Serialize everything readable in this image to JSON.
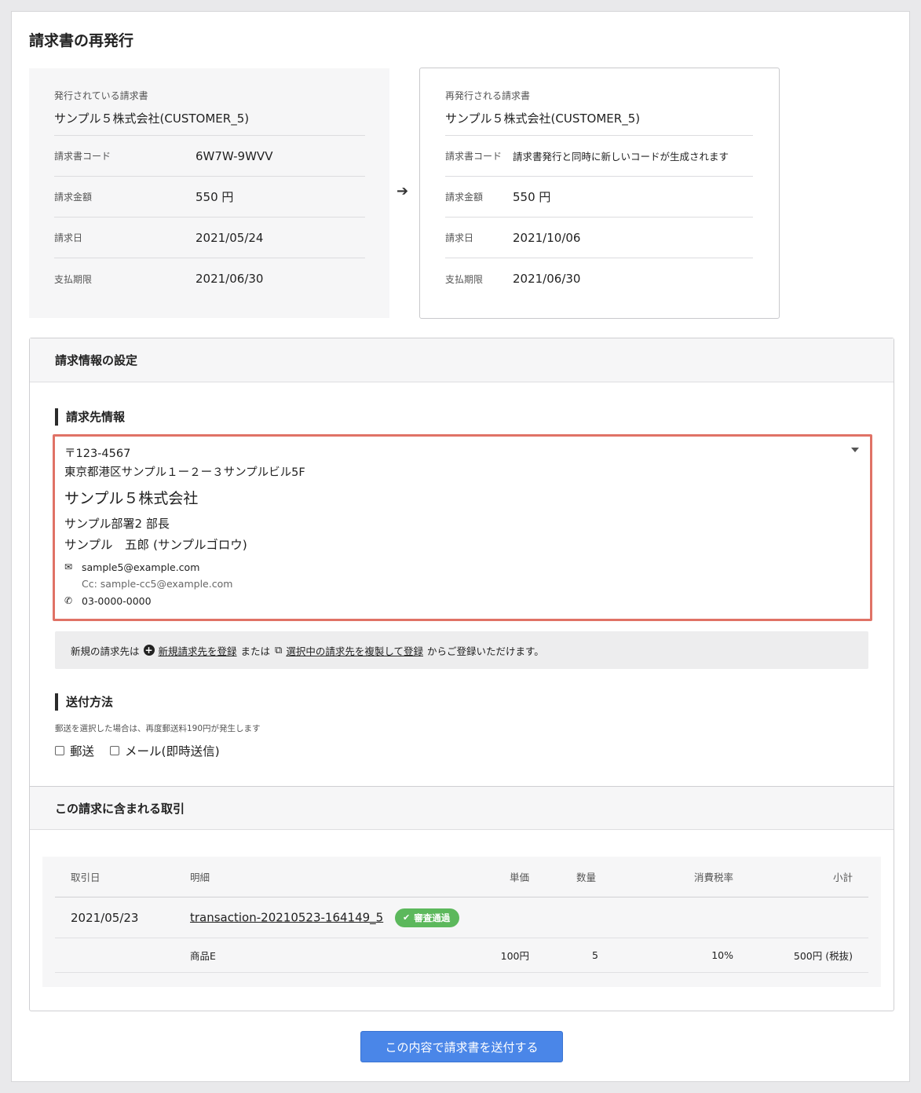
{
  "page": {
    "title": "請求書の再発行"
  },
  "issued_invoice": {
    "caption": "発行されている請求書",
    "customer": "サンプル５株式会社(CUSTOMER_5)",
    "rows": [
      {
        "label": "請求書コード",
        "value": "6W7W-9WVV"
      },
      {
        "label": "請求金額",
        "value": "550 円"
      },
      {
        "label": "請求日",
        "value": "2021/05/24"
      },
      {
        "label": "支払期限",
        "value": "2021/06/30"
      }
    ]
  },
  "reissued_invoice": {
    "caption": "再発行される請求書",
    "customer": "サンプル５株式会社(CUSTOMER_5)",
    "rows": [
      {
        "label": "請求書コード",
        "value": "請求書発行と同時に新しいコードが生成されます"
      },
      {
        "label": "請求金額",
        "value": "550 円"
      },
      {
        "label": "請求日",
        "value": "2021/10/06"
      },
      {
        "label": "支払期限",
        "value": "2021/06/30"
      }
    ]
  },
  "settings": {
    "header": "請求情報の設定",
    "billing_section_title": "請求先情報",
    "billing": {
      "postal": "〒123-4567",
      "address": "東京都港区サンプル１ー２ー３サンプルビル5F",
      "company": "サンプル５株式会社",
      "department": "サンプル部署2 部長",
      "person": "サンプル　五郎 (サンプルゴロウ)",
      "email": "sample5@example.com",
      "cc": "Cc: sample-cc5@example.com",
      "tel": "03-0000-0000"
    },
    "notice": {
      "prefix": "新規の請求先は",
      "new_link": "新規請求先を登録",
      "middle": "または",
      "copy_link": "選択中の請求先を複製して登録",
      "suffix": "からご登録いただけます。"
    },
    "shipping_section_title": "送付方法",
    "shipping_note": "郵送を選択した場合は、再度郵送料190円が発生します",
    "shipping_options": [
      "郵送",
      "メール(即時送信)"
    ]
  },
  "transactions": {
    "header": "この請求に含まれる取引",
    "columns": {
      "date": "取引日",
      "detail": "明細",
      "price": "単価",
      "qty": "数量",
      "tax": "消費税率",
      "subtotal": "小計"
    },
    "row": {
      "date": "2021/05/23",
      "id": "transaction-20210523-164149_5",
      "badge": "審査通過"
    },
    "item": {
      "name": "商品E",
      "price": "100円",
      "qty": "5",
      "tax": "10%",
      "subtotal": "500円 (税抜)"
    }
  },
  "submit_label": "この内容で請求書を送付する",
  "colors": {
    "highlight_border": "#e07266",
    "badge_green": "#5cb85c",
    "primary_button": "#4a86e8"
  }
}
